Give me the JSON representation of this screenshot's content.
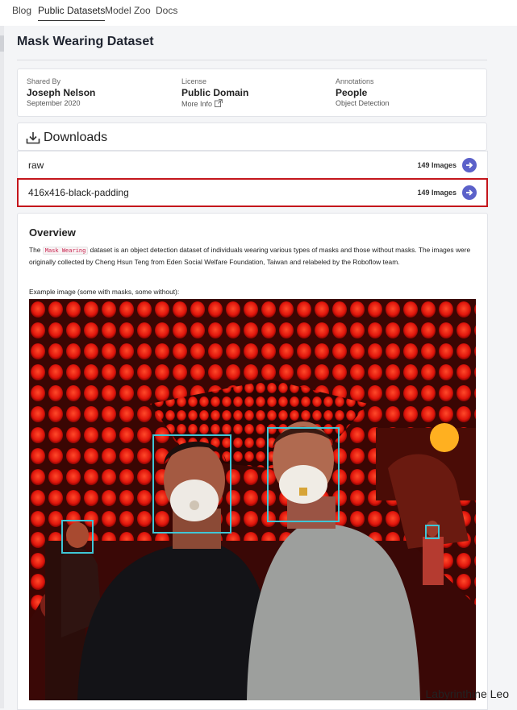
{
  "nav": {
    "items": [
      {
        "label": "Blog",
        "active": false
      },
      {
        "label": "Public Datasets",
        "active": true
      },
      {
        "label": "Model Zoo",
        "active": false
      },
      {
        "label": "Docs",
        "active": false
      }
    ]
  },
  "page": {
    "title": "Mask Wearing Dataset"
  },
  "meta": {
    "shared_by": {
      "label": "Shared By",
      "value": "Joseph Nelson",
      "sub": "September 2020"
    },
    "license": {
      "label": "License",
      "value": "Public Domain",
      "sub": "More Info"
    },
    "annotations": {
      "label": "Annotations",
      "value": "People",
      "sub": "Object Detection"
    }
  },
  "downloads": {
    "title": "Downloads",
    "items": [
      {
        "name": "raw",
        "count": "149 Images",
        "selected": false
      },
      {
        "name": "416x416-black-padding",
        "count": "149 Images",
        "selected": true
      }
    ]
  },
  "overview": {
    "title": "Overview",
    "text_before": "The ",
    "code": "Mask Wearing",
    "text_after": " dataset is an object detection dataset of individuals wearing various types of masks and those without masks. The images were originally collected by Cheng Hsun Teng from Eden Social Welfare Foundation, Taiwan and relabeled by the Roboflow team.",
    "caption": "Example image (some with masks, some without):"
  },
  "watermark": "Labyrinthine Leo",
  "colors": {
    "accent": "#5b61c9",
    "selected_border": "#c4161c",
    "bbox": "#3fc6d6"
  }
}
